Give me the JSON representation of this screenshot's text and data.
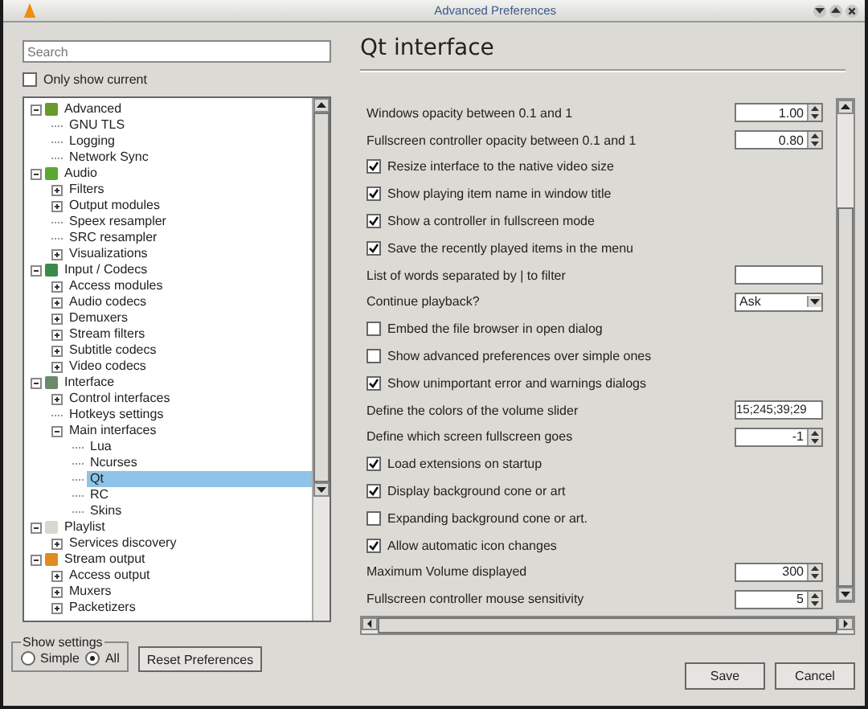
{
  "window": {
    "title": "Advanced Preferences"
  },
  "search": {
    "placeholder": "Search"
  },
  "only_show_current": {
    "label": "Only show current",
    "checked": false
  },
  "tree": {
    "items": [
      {
        "label": "Advanced",
        "expanded": true,
        "selected": false,
        "children": [
          {
            "label": "GNU TLS",
            "selected": false
          },
          {
            "label": "Logging",
            "selected": false
          },
          {
            "label": "Network Sync",
            "selected": false
          }
        ]
      },
      {
        "label": "Audio",
        "expanded": true,
        "selected": false,
        "children": [
          {
            "label": "Filters",
            "expanded": false,
            "selected": false
          },
          {
            "label": "Output modules",
            "expanded": false,
            "selected": false
          },
          {
            "label": "Speex resampler",
            "selected": false
          },
          {
            "label": "SRC resampler",
            "selected": false
          },
          {
            "label": "Visualizations",
            "expanded": false,
            "selected": false
          }
        ]
      },
      {
        "label": "Input / Codecs",
        "expanded": true,
        "selected": false,
        "children": [
          {
            "label": "Access modules",
            "expanded": false,
            "selected": false
          },
          {
            "label": "Audio codecs",
            "expanded": false,
            "selected": false
          },
          {
            "label": "Demuxers",
            "expanded": false,
            "selected": false
          },
          {
            "label": "Stream filters",
            "expanded": false,
            "selected": false
          },
          {
            "label": "Subtitle codecs",
            "expanded": false,
            "selected": false
          },
          {
            "label": "Video codecs",
            "expanded": false,
            "selected": false
          }
        ]
      },
      {
        "label": "Interface",
        "expanded": true,
        "selected": false,
        "children": [
          {
            "label": "Control interfaces",
            "expanded": false,
            "selected": false
          },
          {
            "label": "Hotkeys settings",
            "selected": false
          },
          {
            "label": "Main interfaces",
            "expanded": true,
            "selected": false,
            "children": [
              {
                "label": "Lua",
                "selected": false
              },
              {
                "label": "Ncurses",
                "selected": false
              },
              {
                "label": "Qt",
                "selected": true
              },
              {
                "label": "RC",
                "selected": false
              },
              {
                "label": "Skins",
                "selected": false
              }
            ]
          }
        ]
      },
      {
        "label": "Playlist",
        "expanded": true,
        "selected": false,
        "children": [
          {
            "label": "Services discovery",
            "expanded": false,
            "selected": false
          }
        ]
      },
      {
        "label": "Stream output",
        "expanded": true,
        "selected": false,
        "children": [
          {
            "label": "Access output",
            "expanded": false,
            "selected": false
          },
          {
            "label": "Muxers",
            "expanded": false,
            "selected": false
          },
          {
            "label": "Packetizers",
            "expanded": false,
            "selected": false
          }
        ]
      }
    ]
  },
  "show_settings": {
    "label": "Show settings",
    "options": [
      {
        "label": "Simple",
        "selected": false
      },
      {
        "label": "All",
        "selected": true
      }
    ]
  },
  "reset_button": "Reset Preferences",
  "page": {
    "title": "Qt interface"
  },
  "settings": [
    {
      "kind": "spin",
      "label": "Windows opacity between 0.1 and 1",
      "value": "1.00"
    },
    {
      "kind": "spin",
      "label": "Fullscreen controller opacity between 0.1 and 1",
      "value": "0.80"
    },
    {
      "kind": "check",
      "label": "Resize interface to the native video size",
      "checked": true
    },
    {
      "kind": "check",
      "label": "Show playing item name in window title",
      "checked": true
    },
    {
      "kind": "check",
      "label": "Show a controller in fullscreen mode",
      "checked": true
    },
    {
      "kind": "check",
      "label": "Save the recently played items in the menu",
      "checked": true
    },
    {
      "kind": "text",
      "label": "List of words separated by | to filter"
    },
    {
      "kind": "combo",
      "label": "Continue playback?",
      "value": "Ask"
    },
    {
      "kind": "check",
      "label": "Embed the file browser in open dialog",
      "checked": false
    },
    {
      "kind": "check",
      "label": "Show advanced preferences over simple ones",
      "checked": false
    },
    {
      "kind": "check",
      "label": "Show unimportant error and warnings dialogs",
      "checked": true
    },
    {
      "kind": "text",
      "label": "Define the colors of the volume slider",
      "value": "15;245;39;29"
    },
    {
      "kind": "spin",
      "label": "Define which screen fullscreen goes",
      "value": "-1"
    },
    {
      "kind": "check",
      "label": "Load extensions on startup",
      "checked": true
    },
    {
      "kind": "check",
      "label": "Display background cone or art",
      "checked": true
    },
    {
      "kind": "check",
      "label": "Expanding background cone or art.",
      "checked": false
    },
    {
      "kind": "check",
      "label": "Allow automatic icon changes",
      "checked": true
    },
    {
      "kind": "spin",
      "label": "Maximum Volume displayed",
      "value": "300"
    },
    {
      "kind": "spin",
      "label": "Fullscreen controller mouse sensitivity",
      "value": "5"
    }
  ],
  "buttons": [
    {
      "label": "Save"
    },
    {
      "label": "Cancel"
    }
  ]
}
